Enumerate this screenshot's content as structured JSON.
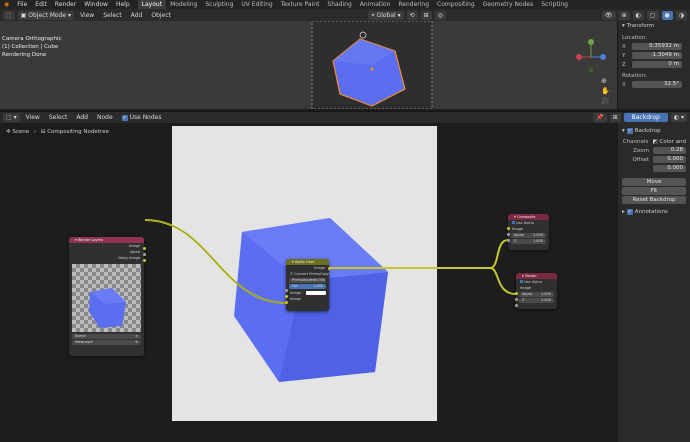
{
  "topbar": {
    "menus": [
      "File",
      "Edit",
      "Render",
      "Window",
      "Help"
    ],
    "tabs": [
      "Layout",
      "Modeling",
      "Sculpting",
      "UV Editing",
      "Texture Paint",
      "Shading",
      "Animation",
      "Rendering",
      "Compositing",
      "Geometry Nodes",
      "Scripting"
    ],
    "active_tab": "Layout"
  },
  "viewport": {
    "mode": "Object Mode",
    "menus": [
      "View",
      "Select",
      "Add",
      "Object"
    ],
    "orientation": "Global",
    "overlay_lines": [
      "Camera Orthographic",
      "(1) Collection | Cube",
      "Rendering Done"
    ]
  },
  "transform_panel": {
    "title": "Transform",
    "location_label": "Location:",
    "location": [
      {
        "axis": "X",
        "value": "0.35932 m"
      },
      {
        "axis": "Y",
        "value": "-1.3049 m"
      },
      {
        "axis": "Z",
        "value": "0 m"
      }
    ],
    "rotation_label": "Rotation:",
    "rotation": [
      {
        "axis": "X",
        "value": "32.5°"
      }
    ]
  },
  "node_editor": {
    "menus": [
      "View",
      "Select",
      "Add",
      "Node"
    ],
    "use_nodes_label": "Use Nodes",
    "breadcrumb_scene": "Scene",
    "breadcrumb_tree": "Compositing Nodetree",
    "backdrop_button": "Backdrop"
  },
  "sidebar": {
    "backdrop_label": "Backdrop",
    "channels_label": "Channels",
    "channels_value": "Color and",
    "zoom_label": "Zoom",
    "zoom_value": "0.28",
    "offset_label": "Offset",
    "offset_x": "0.000",
    "offset_y": "0.000",
    "move_btn": "Move",
    "fit_btn": "Fit",
    "reset_btn": "Reset Backdrop",
    "annotations_label": "Annotations"
  },
  "nodes": {
    "render_layers": {
      "title": "Render Layers",
      "outputs": [
        "Image",
        "Alpha",
        "Noisy Image"
      ],
      "scene": "Scene",
      "layer": "ViewLayer"
    },
    "alpha_over": {
      "title": "Alpha Over",
      "output": "Image",
      "convert_premul": "Convert Premultiply",
      "premul_label": "Premultiplied",
      "premul_value": "0.000",
      "fac_label": "Fac",
      "fac_value": "1.000",
      "inputs": [
        "Image",
        "Image"
      ]
    },
    "composite": {
      "title": "Composite",
      "use_alpha": "Use Alpha",
      "inputs": [
        "Image"
      ],
      "alpha_label": "Alpha",
      "alpha_value": "1.000",
      "z_label": "Z",
      "z_value": "1.000"
    },
    "viewer": {
      "title": "Viewer",
      "use_alpha": "Use Alpha",
      "inputs": [
        "Image"
      ],
      "alpha_label": "Alpha",
      "alpha_value": "1.000",
      "z_label": "Z",
      "z_value": "1.000"
    }
  },
  "colors": {
    "accent": "#4772b3",
    "cube_blue": "#5b6ef0",
    "backdrop_bg": "#e4e4e4",
    "link_yellow": "#c7c729",
    "render_layers_header": "#8d3550",
    "alpha_over_header": "#6e6e1e",
    "output_header": "#7a2940"
  }
}
